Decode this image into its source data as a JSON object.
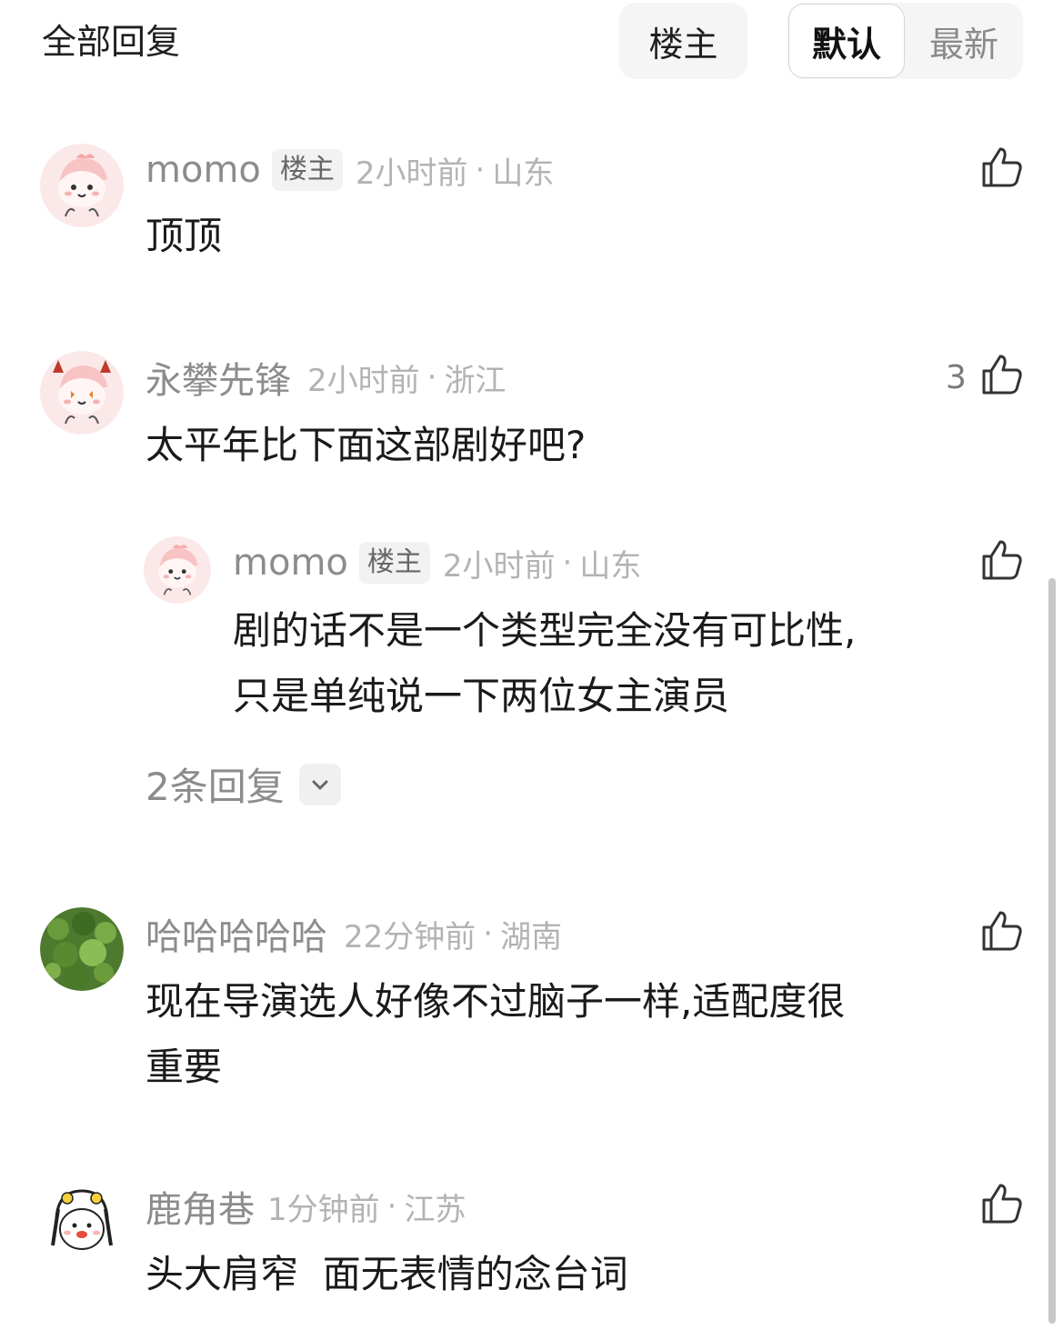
{
  "header": {
    "title": "全部回复",
    "op_filter": "楼主",
    "sort_default": "默认",
    "sort_latest": "最新"
  },
  "comments": [
    {
      "username": "momo",
      "badge": "楼主",
      "time": "2小时前",
      "dot": "·",
      "location": "山东",
      "text": "顶顶",
      "likes": ""
    },
    {
      "username": "永攀先锋",
      "time": "2小时前",
      "dot": "·",
      "location": "浙江",
      "text": "太平年比下面这部剧好吧?",
      "likes": "3",
      "reply": {
        "username": "momo",
        "badge": "楼主",
        "time": "2小时前",
        "dot": "·",
        "location": "山东",
        "text_line1": "剧的话不是一个类型完全没有可比性,",
        "text_line2": "只是单纯说一下两位女主演员"
      },
      "more_replies": "2条回复"
    },
    {
      "username": "哈哈哈哈哈",
      "time": "22分钟前",
      "dot": "·",
      "location": "湖南",
      "text_line1": "现在导演选人好像不过脑子一样,适配度很",
      "text_line2": "重要"
    },
    {
      "username": "鹿角巷",
      "time": "1分钟前",
      "dot": "·",
      "location": "江苏",
      "text": "头大肩窄  面无表情的念台词"
    }
  ],
  "icons": {
    "like": "thumbs-up-icon",
    "expand": "chevron-down-icon"
  },
  "colors": {
    "meta_gray": "#b3b3b3",
    "name_gray": "#8c8c8c",
    "avatar_pink": "#fde3e3"
  }
}
